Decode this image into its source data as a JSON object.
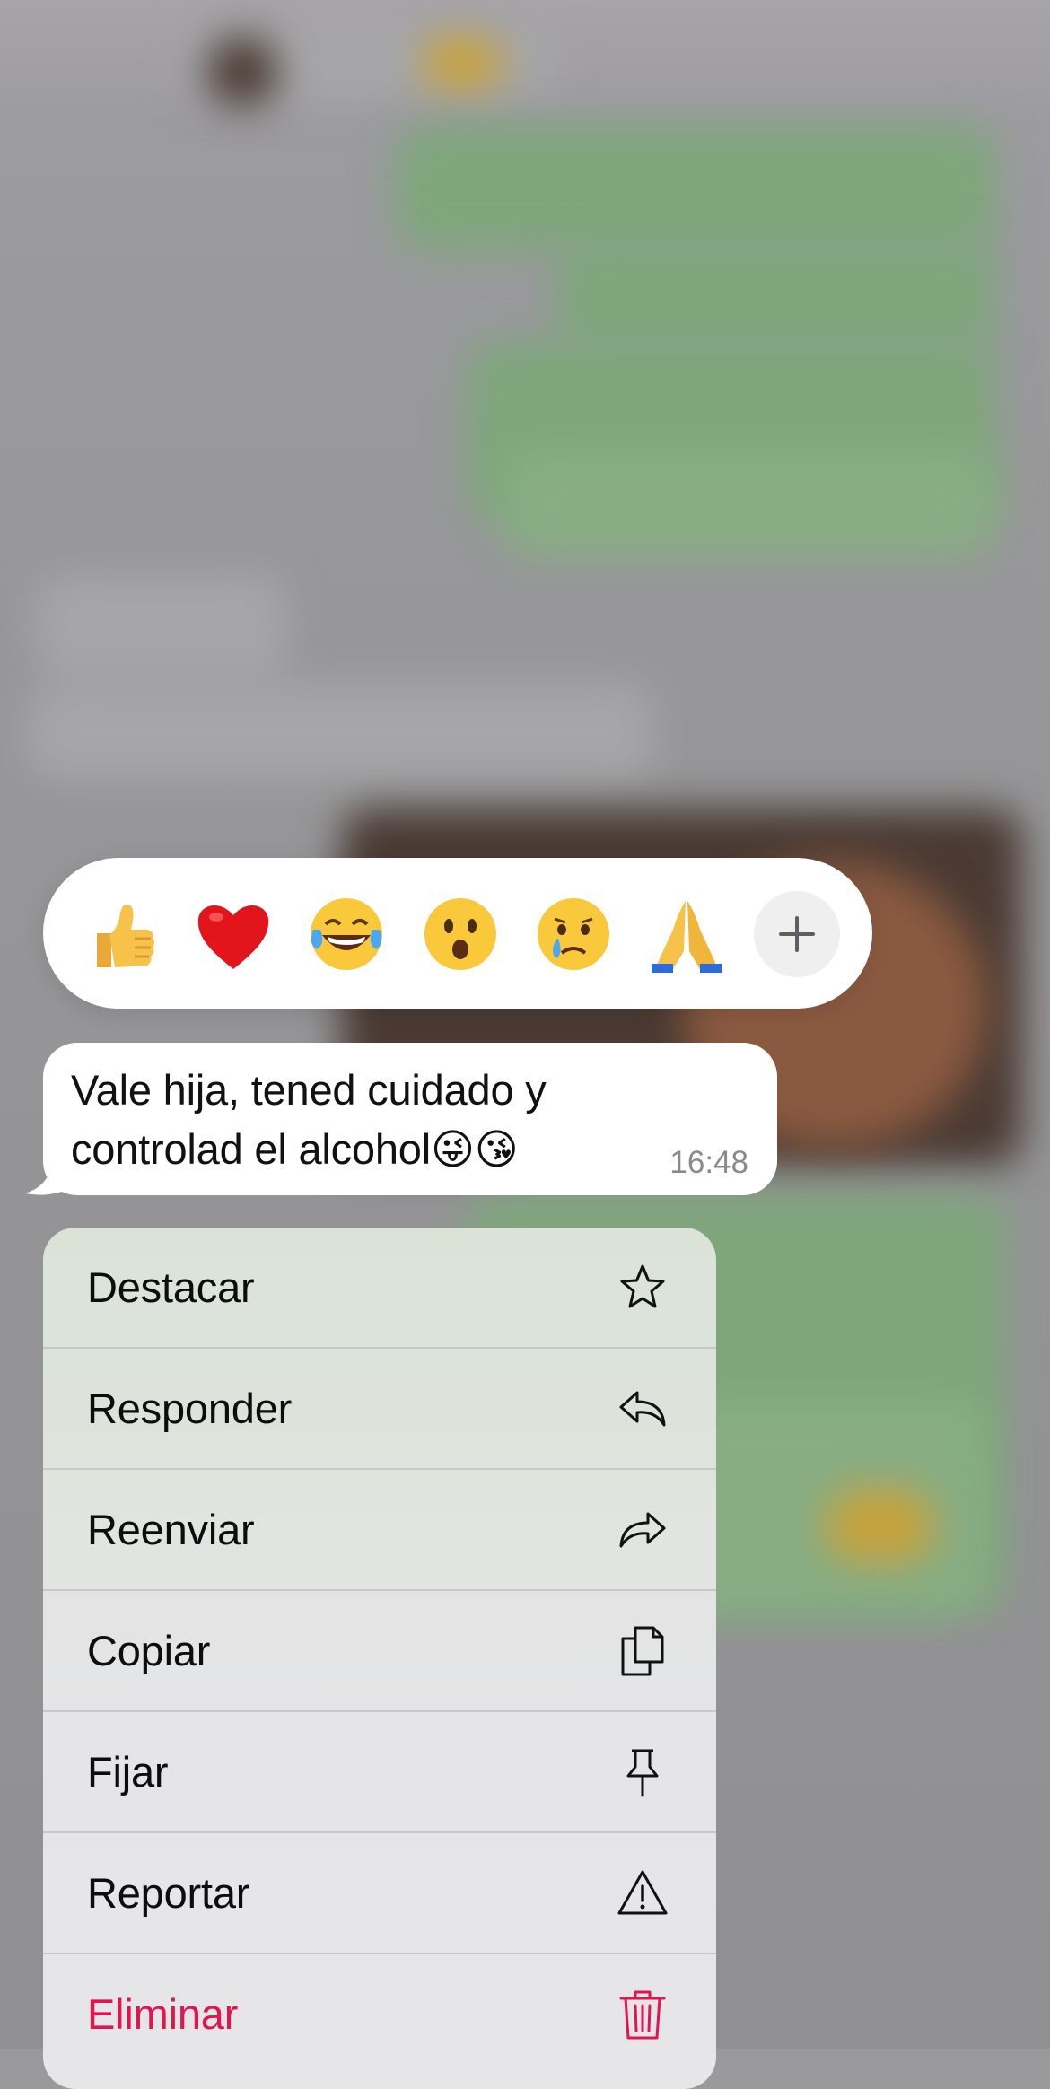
{
  "reactions": [
    {
      "icon": "thumbs-up-emoji"
    },
    {
      "icon": "red-heart-emoji"
    },
    {
      "icon": "tears-of-joy-emoji"
    },
    {
      "icon": "surprised-face-emoji"
    },
    {
      "icon": "crying-face-emoji"
    },
    {
      "icon": "folded-hands-emoji"
    }
  ],
  "reaction_more_icon": "plus-icon",
  "message": {
    "text": "Vale hija, tened cuidado y\ncontrolad el alcohol😜😘",
    "time": "16:48"
  },
  "menu": {
    "items": [
      {
        "label": "Destacar",
        "icon": "star-icon"
      },
      {
        "label": "Responder",
        "icon": "reply-icon"
      },
      {
        "label": "Reenviar",
        "icon": "forward-icon"
      },
      {
        "label": "Copiar",
        "icon": "copy-icon"
      },
      {
        "label": "Fijar",
        "icon": "pin-icon"
      },
      {
        "label": "Reportar",
        "icon": "warning-icon"
      },
      {
        "label": "Eliminar",
        "icon": "trash-icon",
        "color": "#e0174f"
      }
    ]
  },
  "colors": {
    "danger": "#e0174f",
    "chat_bubble_outgoing": "#7ea67b",
    "overlay": "#9a9a9c"
  }
}
